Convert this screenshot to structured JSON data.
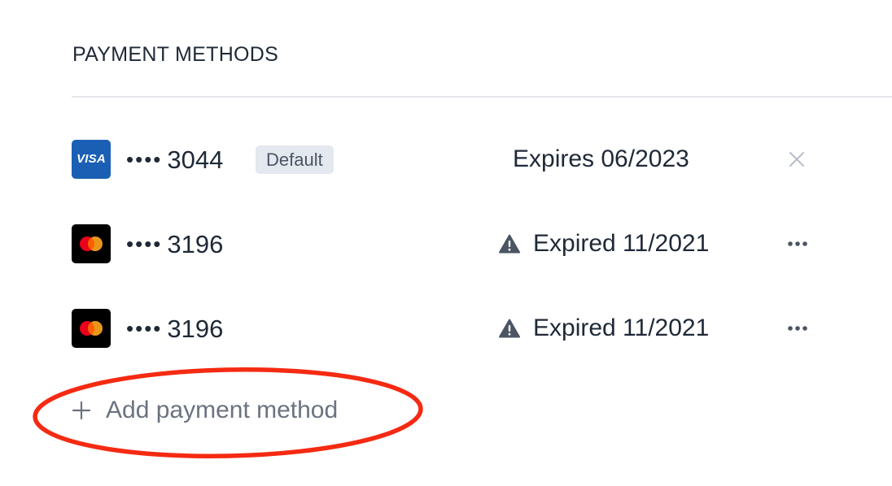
{
  "section": {
    "title": "PAYMENT METHODS"
  },
  "payment_methods": [
    {
      "brand": "VISA",
      "brand_icon": "visa-logo-icon",
      "masked_prefix": "••••",
      "last4": "3044",
      "badge": "Default",
      "expiry_text": "Expires 06/2023",
      "status": "valid",
      "action_icon": "close-icon"
    },
    {
      "brand": "mastercard",
      "brand_icon": "mastercard-logo-icon",
      "masked_prefix": "••••",
      "last4": "3196",
      "expiry_text": "Expired 11/2021",
      "status": "expired",
      "status_icon": "warning-icon",
      "action_icon": "more-horizontal-icon"
    },
    {
      "brand": "mastercard",
      "brand_icon": "mastercard-logo-icon",
      "masked_prefix": "••••",
      "last4": "3196",
      "expiry_text": "Expired 11/2021",
      "status": "expired",
      "status_icon": "warning-icon",
      "action_icon": "more-horizontal-icon"
    }
  ],
  "add_button": {
    "label": "Add payment method",
    "icon": "plus-icon"
  },
  "colors": {
    "visa_blue": "#1a5fb4",
    "mastercard_red": "#eb001b",
    "mastercard_orange": "#f79e1b",
    "annotation_red": "#f52a12",
    "badge_bg": "#e4e8ef"
  }
}
